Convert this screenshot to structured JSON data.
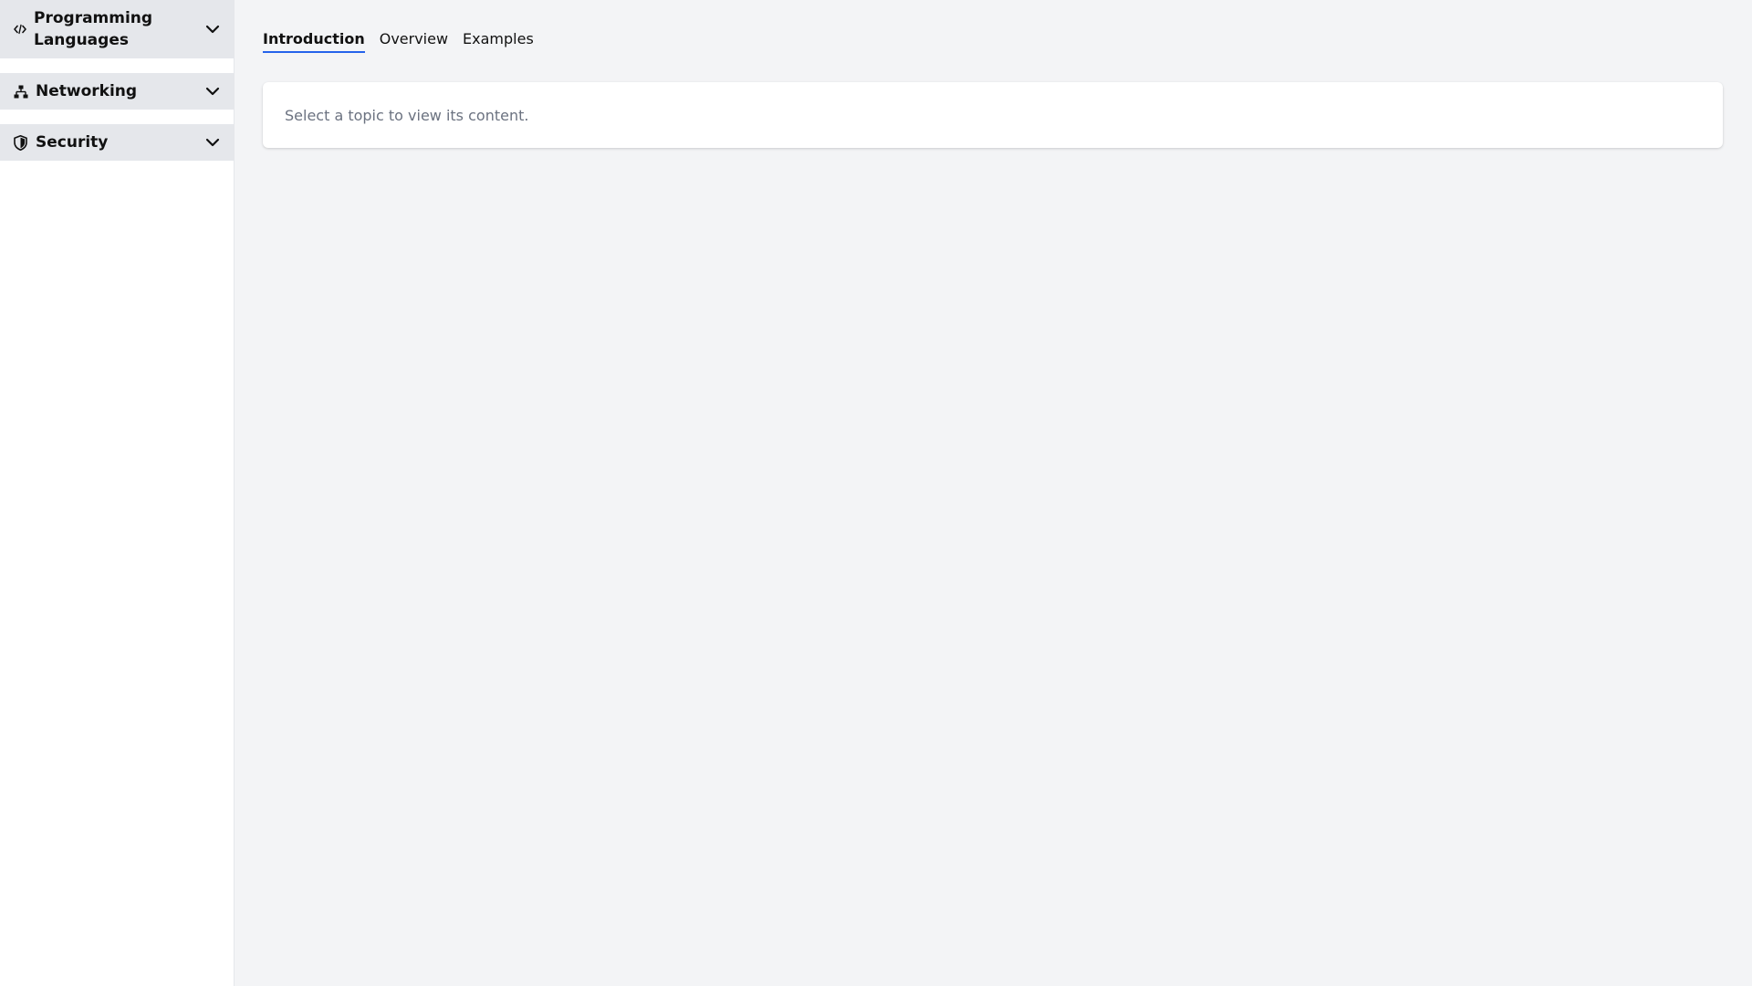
{
  "sidebar": {
    "sections": [
      {
        "label": "Programming Languages",
        "icon": "code-icon"
      },
      {
        "label": "Networking",
        "icon": "network-icon"
      },
      {
        "label": "Security",
        "icon": "shield-icon"
      }
    ]
  },
  "tabs": [
    {
      "label": "Introduction",
      "active": true
    },
    {
      "label": "Overview",
      "active": false
    },
    {
      "label": "Examples",
      "active": false
    }
  ],
  "content": {
    "placeholder": "Select a topic to view its content."
  },
  "colors": {
    "accent": "#2563eb",
    "sidebar_header_bg": "#e5e7eb",
    "main_bg": "#f3f4f6",
    "muted_text": "#6b7280"
  }
}
